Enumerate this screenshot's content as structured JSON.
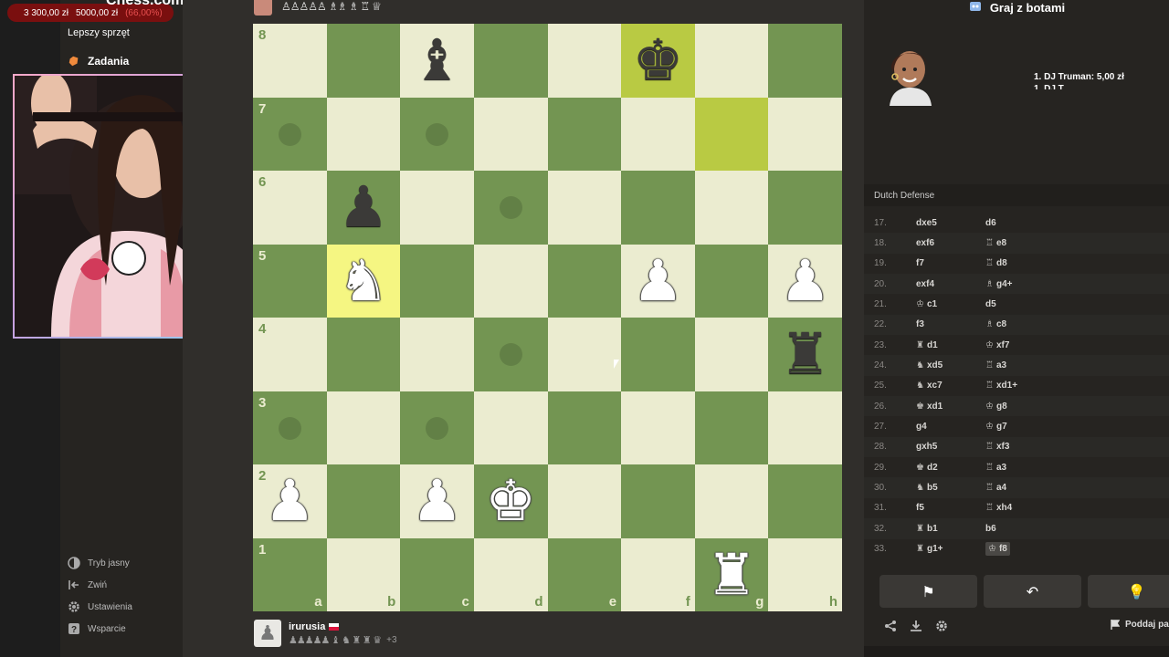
{
  "donation": {
    "current": "3 300,00 zł",
    "goal": "5000,00 zł",
    "percent": "(66,00%)"
  },
  "brand": {
    "logo": "Chess.com"
  },
  "sidebar": {
    "items": [
      {
        "label": "Lepszy sprzęt",
        "icon": "gear-icon"
      },
      {
        "label": "Zadania",
        "icon": "puzzle-icon"
      }
    ],
    "bottom": [
      {
        "label": "Tryb jasny",
        "icon": "contrast-icon"
      },
      {
        "label": "Zwiń",
        "icon": "collapse-icon"
      },
      {
        "label": "Ustawienia",
        "icon": "settings-icon"
      },
      {
        "label": "Wsparcie",
        "icon": "help-icon"
      }
    ]
  },
  "opponent_top": {
    "captured": "♙♙♙♙♙ ♗♗ ♗ ♖ ♕"
  },
  "board": {
    "ranks": [
      "8",
      "7",
      "6",
      "5",
      "4",
      "3",
      "2",
      "1"
    ],
    "files": [
      "a",
      "b",
      "c",
      "d",
      "e",
      "f",
      "g",
      "h"
    ],
    "pieces": [
      {
        "sq": "c8",
        "glyph": "♝",
        "color": "b"
      },
      {
        "sq": "f8",
        "glyph": "♚",
        "color": "b"
      },
      {
        "sq": "b6",
        "glyph": "♟",
        "color": "b"
      },
      {
        "sq": "b5",
        "glyph": "♞",
        "color": "w"
      },
      {
        "sq": "f5",
        "glyph": "♟",
        "color": "w"
      },
      {
        "sq": "h5",
        "glyph": "♟",
        "color": "w"
      },
      {
        "sq": "h4",
        "glyph": "♜",
        "color": "b"
      },
      {
        "sq": "a2",
        "glyph": "♟",
        "color": "w"
      },
      {
        "sq": "c2",
        "glyph": "♟",
        "color": "w"
      },
      {
        "sq": "d2",
        "glyph": "♚",
        "color": "w"
      },
      {
        "sq": "g1",
        "glyph": "♜",
        "color": "w"
      }
    ],
    "highlight_yellow": [
      "b5"
    ],
    "highlight_green": [
      "f8",
      "g7"
    ],
    "move_dots": [
      "a7",
      "c7",
      "d6",
      "d4",
      "a3",
      "c3"
    ]
  },
  "player_bottom": {
    "name": "irurusia",
    "flag": "PL",
    "captured": "♟♟♟♟♟ ♝ ♞ ♜ ♜ ♛",
    "plus": "+3"
  },
  "right_panel": {
    "title": "Graj z botami",
    "bot_list": [
      "1. DJ Truman: 5,00 zł",
      "1. DJ T..."
    ],
    "opening": "Dutch Defense",
    "moves": [
      {
        "n": "17.",
        "w": "dxe5",
        "wf": "",
        "b": "d6",
        "bf": ""
      },
      {
        "n": "18.",
        "w": "exf6",
        "wf": "",
        "b": "e8",
        "bf": "♖"
      },
      {
        "n": "19.",
        "w": "f7",
        "wf": "",
        "b": "d8",
        "bf": "♖"
      },
      {
        "n": "20.",
        "w": "exf4",
        "wf": "",
        "b": "g4+",
        "bf": "♗"
      },
      {
        "n": "21.",
        "w": "c1",
        "wf": "♔",
        "b": "d5",
        "bf": ""
      },
      {
        "n": "22.",
        "w": "f3",
        "wf": "",
        "b": "c8",
        "bf": "♗"
      },
      {
        "n": "23.",
        "w": "d1",
        "wf": "♜",
        "b": "xf7",
        "bf": "♔"
      },
      {
        "n": "24.",
        "w": "xd5",
        "wf": "♞",
        "b": "a3",
        "bf": "♖"
      },
      {
        "n": "25.",
        "w": "xc7",
        "wf": "♞",
        "b": "xd1+",
        "bf": "♖"
      },
      {
        "n": "26.",
        "w": "xd1",
        "wf": "♚",
        "b": "g8",
        "bf": "♔"
      },
      {
        "n": "27.",
        "w": "g4",
        "wf": "",
        "b": "g7",
        "bf": "♔"
      },
      {
        "n": "28.",
        "w": "gxh5",
        "wf": "",
        "b": "xf3",
        "bf": "♖"
      },
      {
        "n": "29.",
        "w": "d2",
        "wf": "♚",
        "b": "a3",
        "bf": "♖"
      },
      {
        "n": "30.",
        "w": "b5",
        "wf": "♞",
        "b": "a4",
        "bf": "♖"
      },
      {
        "n": "31.",
        "w": "f5",
        "wf": "",
        "b": "xh4",
        "bf": "♖"
      },
      {
        "n": "32.",
        "w": "b1",
        "wf": "♜",
        "b": "b6",
        "bf": ""
      },
      {
        "n": "33.",
        "w": "g1+",
        "wf": "♜",
        "b": "f8",
        "bf": "♔"
      }
    ],
    "actions": [
      "⚑",
      "↶",
      "💡"
    ],
    "footer_icons": [
      "share-icon",
      "download-icon",
      "settings-icon"
    ],
    "resign_label": "Poddaj pa"
  }
}
